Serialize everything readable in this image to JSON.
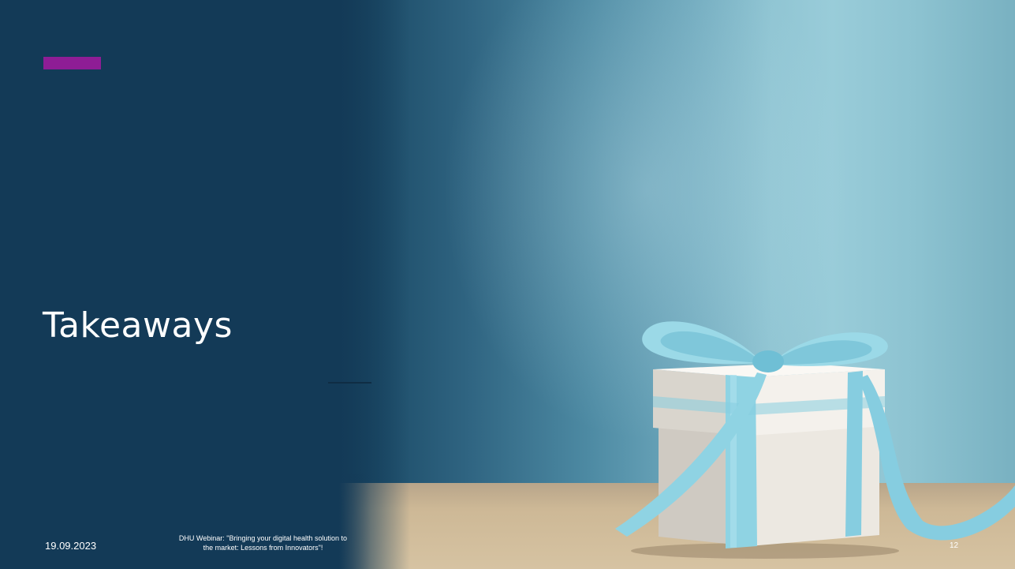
{
  "slide": {
    "title": "Takeaways",
    "accent_color": "#8e1d95",
    "background_color": "#133a57",
    "image": "gift-box-with-blue-ribbon"
  },
  "footer": {
    "date": "19.09.2023",
    "text_line1": "DHU Webinar: \"Bringing your digital health solution to",
    "text_line2": "the market: Lessons from Innovators\"!",
    "page_number": "12"
  }
}
